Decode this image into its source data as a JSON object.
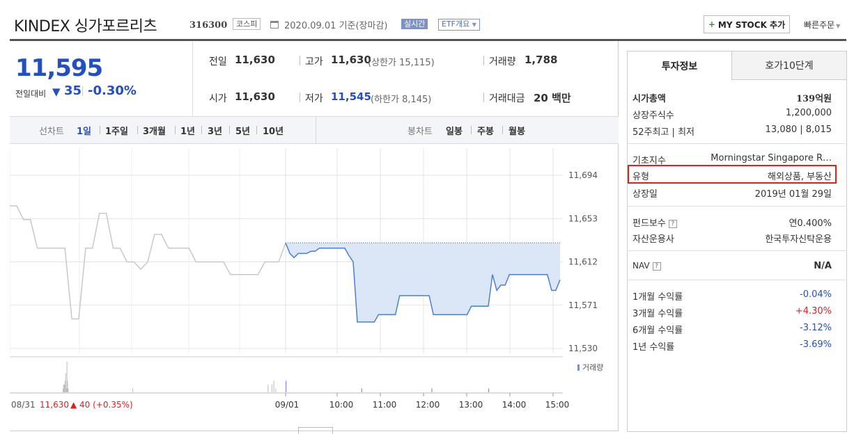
{
  "header": {
    "name": "KINDEX 싱가포르리츠",
    "code": "316300",
    "market_tag": "코스피",
    "date_text": "2020.09.01 기준(장마감)",
    "realtime_label": "실시간",
    "etf_button": "ETF개요",
    "my_stock_button": "MY STOCK 추가",
    "my_stock_plus": "+",
    "quick_order": "빠른주문"
  },
  "summary": {
    "price": "11,595",
    "diff_label": "전일대비",
    "diff_arrow": "▼",
    "diff_value": "35",
    "diff_pct": "-0.30%",
    "prev_label": "전일",
    "prev_value": "11,630",
    "high_label": "고가",
    "high_value": "11,630",
    "high_sub": "(상한가 15,115)",
    "volume_label": "거래량",
    "volume_value": "1,788",
    "open_label": "시가",
    "open_value": "11,630",
    "low_label": "저가",
    "low_value": "11,545",
    "low_sub": "(하한가 8,145)",
    "amount_label": "거래대금",
    "amount_value": "20 백만"
  },
  "chart_tabs": {
    "line_label": "선차트",
    "line_items": [
      "1일",
      "1주일",
      "3개월",
      "1년",
      "3년",
      "5년",
      "10년"
    ],
    "candle_label": "봉차트",
    "candle_items": [
      "일봉",
      "주봉",
      "월봉"
    ]
  },
  "chart_data": {
    "type": "line",
    "y_ticks": [
      "11,694",
      "11,653",
      "11,612",
      "11,571",
      "11,530"
    ],
    "x_ticks": [
      "09/01",
      "10:00",
      "11:00",
      "12:00",
      "13:00",
      "14:00",
      "15:00"
    ],
    "prev_day_label": "08/31",
    "prev_day_value": "11,630",
    "prev_day_change": "▲ 40 (+0.35%)",
    "volume_legend": "거래량",
    "ylim": [
      11530,
      11694
    ],
    "grid": true,
    "colors": {
      "today_line": "#4a7fd6",
      "today_fill": "#dbe6f6",
      "prev_line": "#c8c8c8",
      "prev_close": "#3355aa",
      "volume_bar": "#bbbbbb",
      "volume_today": "#7d8fd0"
    },
    "prev_series": [
      11665,
      11665,
      11652,
      11652,
      11625,
      11625,
      11625,
      11625,
      11625,
      11558,
      11558,
      11625,
      11625,
      11658,
      11658,
      11625,
      11625,
      11612,
      11612,
      11605,
      11612,
      11638,
      11638,
      11625,
      11625,
      11625,
      11625,
      11612,
      11612,
      11612,
      11612,
      11612,
      11600,
      11600,
      11600,
      11600,
      11600,
      11612,
      11612,
      11612,
      11630
    ],
    "today_series": [
      11630,
      11620,
      11616,
      11620,
      11620,
      11620,
      11622,
      11622,
      11625,
      11625,
      11625,
      11625,
      11625,
      11625,
      11625,
      11618,
      11612,
      11555,
      11555,
      11555,
      11555,
      11555,
      11562,
      11562,
      11562,
      11562,
      11562,
      11580,
      11580,
      11580,
      11580,
      11580,
      11580,
      11580,
      11580,
      11562,
      11562,
      11562,
      11562,
      11562,
      11562,
      11562,
      11562,
      11562,
      11570,
      11570,
      11570,
      11570,
      11570,
      11600,
      11585,
      11590,
      11590,
      11600,
      11600,
      11600,
      11600,
      11600,
      11600,
      11600,
      11600,
      11600,
      11600,
      11585,
      11585,
      11595
    ],
    "prev_volumes": [
      0,
      0,
      0,
      0,
      0,
      0,
      0,
      0,
      0,
      0,
      0,
      0,
      0,
      0,
      0,
      0,
      0,
      0,
      0,
      0,
      0,
      0,
      0,
      0,
      0,
      0,
      0,
      0,
      0,
      0,
      0,
      0,
      0,
      0,
      0,
      0,
      0,
      0,
      0,
      0,
      0,
      0,
      0,
      0,
      0,
      0,
      0,
      0,
      0,
      0,
      0,
      0,
      0,
      0,
      0,
      0,
      0,
      0,
      0,
      0,
      0,
      0,
      0,
      0,
      0,
      0,
      0,
      0,
      0,
      0,
      0,
      0,
      0,
      0,
      0,
      0,
      0,
      0,
      0,
      0,
      0,
      0,
      0,
      1,
      2,
      2,
      3,
      5,
      1,
      8,
      3,
      1,
      0,
      0,
      0,
      0,
      0,
      0,
      0,
      0,
      0,
      0,
      0,
      0,
      0,
      0,
      0,
      0,
      0,
      0,
      0,
      0,
      0,
      0,
      0,
      0,
      0,
      0,
      0,
      0,
      0,
      0,
      0,
      0,
      0,
      0,
      0,
      0,
      0,
      0,
      0,
      0,
      0,
      0,
      0,
      0,
      0,
      0,
      0,
      0,
      0,
      0,
      0,
      0,
      0,
      0,
      0,
      0,
      0,
      0,
      0,
      0,
      0,
      0,
      0,
      0,
      0,
      0,
      0,
      0,
      0,
      0,
      0,
      0,
      0,
      0,
      0,
      0,
      0,
      0,
      0,
      0,
      0,
      0,
      0,
      0,
      0,
      0,
      0,
      0,
      0,
      0,
      0,
      0,
      0,
      0,
      0,
      0,
      0,
      0,
      0,
      0,
      1,
      0,
      0,
      0,
      0,
      0,
      0,
      0,
      0,
      0,
      0,
      0,
      0,
      0,
      0,
      0,
      0,
      0,
      0,
      0,
      0,
      0,
      0,
      0,
      0,
      0,
      0,
      0,
      0,
      0,
      0,
      0,
      0,
      0,
      0,
      0,
      0,
      0,
      0,
      0,
      0,
      0,
      0,
      0,
      0,
      0,
      0,
      0,
      0,
      0,
      0,
      0,
      0,
      0,
      0,
      0,
      0,
      0,
      0,
      0,
      0,
      0,
      0,
      0,
      0,
      0,
      0,
      0,
      0,
      0,
      0,
      0,
      0,
      0,
      0,
      0,
      0,
      0,
      0,
      0,
      0,
      0,
      0,
      0,
      0,
      0,
      0,
      0,
      0,
      0,
      0,
      0,
      0,
      0,
      0,
      0,
      0,
      0,
      0,
      0,
      0,
      0,
      0,
      0,
      0,
      0,
      0,
      0,
      0,
      0,
      0,
      0,
      0,
      0,
      0,
      0,
      0,
      0,
      0,
      0,
      0,
      0,
      0,
      0,
      0,
      0,
      0,
      0,
      0,
      0,
      0,
      0,
      0,
      0,
      0,
      0,
      0,
      0,
      0,
      0,
      0,
      0,
      0,
      0,
      0,
      0,
      0,
      0,
      0,
      0,
      0,
      0,
      0,
      0,
      0,
      0,
      0,
      0,
      0,
      0,
      0,
      0,
      0,
      0,
      0,
      0,
      0,
      0,
      0,
      0,
      0,
      0,
      0,
      0,
      0,
      0,
      0,
      0,
      0,
      0,
      0,
      0,
      0,
      0,
      0,
      0,
      0,
      0,
      0,
      0,
      0,
      0,
      0,
      0,
      0,
      0,
      0,
      0,
      0,
      0,
      0,
      0,
      0,
      0,
      0,
      0,
      0,
      0,
      0,
      0,
      0,
      0,
      2,
      0,
      0,
      0,
      0,
      0,
      2,
      0,
      0,
      3,
      0,
      0,
      1,
      0,
      0,
      0,
      0,
      0,
      0,
      0,
      0,
      0,
      0,
      0,
      0,
      0,
      0,
      0,
      0
    ],
    "today_volumes": [
      3,
      0,
      0,
      0,
      0,
      0,
      0,
      0,
      0,
      0,
      0,
      0,
      0,
      0,
      0,
      0,
      0,
      0,
      0,
      0,
      0,
      0,
      0,
      0,
      0,
      0,
      0,
      0,
      0,
      0,
      0,
      0,
      0,
      0,
      0,
      0,
      0,
      0,
      0,
      0,
      0,
      0,
      0,
      0,
      0,
      0,
      0,
      0,
      0,
      0,
      0,
      0,
      0,
      0,
      0,
      0,
      0,
      0,
      0,
      0,
      0,
      0,
      0,
      0,
      0,
      0,
      0,
      0,
      0,
      0,
      0,
      0,
      0,
      0,
      0,
      0,
      0,
      0,
      0,
      0,
      0,
      0,
      0,
      0,
      0,
      0,
      0,
      0,
      0,
      0,
      0,
      0,
      0,
      0,
      0,
      0,
      0,
      0,
      0,
      0,
      0,
      0,
      0,
      0,
      0,
      0,
      0,
      0,
      0,
      0,
      0,
      0,
      0,
      0,
      0,
      0,
      0,
      0,
      0,
      0,
      0,
      0,
      0,
      0,
      0,
      0,
      0,
      0,
      0,
      0,
      0,
      0,
      0,
      0,
      0,
      0,
      1,
      0,
      0,
      0,
      0,
      0,
      0,
      0,
      0,
      0,
      0,
      0,
      0,
      0,
      0,
      0,
      0,
      0,
      0,
      0,
      0,
      0,
      0,
      0,
      0,
      0,
      0,
      0,
      0,
      0,
      0,
      0,
      0,
      0,
      0,
      0,
      0,
      0,
      0,
      0,
      0,
      0,
      0,
      0,
      0,
      0,
      0,
      0,
      0,
      0,
      0,
      0,
      0,
      0,
      0,
      0,
      0,
      0,
      0,
      0,
      0,
      0,
      0,
      0,
      0,
      0,
      0,
      0,
      0,
      0,
      0,
      0,
      0,
      0,
      0,
      0,
      0,
      0,
      0,
      0,
      0,
      0,
      0,
      0,
      0,
      0,
      0,
      0,
      0,
      0,
      0,
      0,
      0,
      0,
      0,
      0,
      0,
      0,
      0,
      0,
      0,
      0,
      0,
      0,
      0,
      0,
      0,
      0,
      0,
      0,
      0,
      0,
      0,
      0,
      0,
      0,
      0,
      0,
      0,
      0,
      0,
      0,
      0,
      0,
      0,
      0,
      1,
      0,
      0,
      0,
      0,
      0,
      0,
      0,
      0,
      0,
      0,
      0,
      0,
      0,
      0,
      0,
      0,
      0,
      0,
      0,
      0,
      0,
      0,
      0,
      0,
      0,
      0,
      0,
      0,
      0,
      0,
      0,
      0,
      0,
      0,
      0,
      0,
      0,
      0,
      0,
      0,
      0,
      0,
      0,
      0,
      0,
      0,
      0,
      0,
      0,
      0,
      0,
      0,
      0,
      0,
      0,
      0,
      0,
      0,
      0,
      0,
      0,
      0,
      0,
      0,
      0,
      0,
      0,
      0,
      0,
      0,
      0,
      0,
      0,
      0,
      0,
      0,
      0,
      0,
      0,
      0,
      0,
      0,
      0,
      0,
      0,
      0,
      0,
      0,
      0,
      0,
      0,
      0,
      0,
      0,
      0,
      0,
      0,
      0,
      0,
      0,
      0,
      1,
      0,
      0,
      0,
      0,
      0,
      0,
      0,
      0,
      0,
      0,
      0,
      0,
      0,
      0,
      0,
      0,
      0,
      0,
      0,
      0,
      0,
      0,
      0,
      0,
      0,
      0,
      0,
      0,
      0,
      0,
      0,
      0,
      0,
      0,
      0,
      0,
      0,
      0,
      0,
      0,
      0,
      0,
      0,
      0,
      0,
      0,
      0,
      0,
      0,
      0,
      0,
      0,
      0,
      0,
      0,
      0,
      0,
      0,
      0,
      0,
      0,
      0,
      0,
      0,
      0,
      0,
      0,
      0,
      0,
      0,
      0,
      0,
      0,
      0,
      0,
      0,
      0,
      0,
      0,
      0,
      0,
      0,
      0,
      0,
      0,
      0,
      0,
      0,
      0,
      0,
      0,
      0,
      0,
      0,
      0,
      0,
      0,
      0,
      0,
      0,
      0,
      0,
      0,
      0,
      0,
      0,
      0,
      0,
      0,
      0,
      0,
      0,
      0,
      0,
      0,
      0,
      0,
      0,
      0,
      0,
      0,
      0,
      0,
      0,
      0,
      0,
      0,
      0,
      0
    ]
  },
  "right_panel": {
    "tab_active": "투자정보",
    "tab_inactive": "호가10단계",
    "market_cap_label": "시가총액",
    "market_cap_value": "139억원",
    "shares_label": "상장주식수",
    "shares_value": "1,200,000",
    "week52_label": "52주최고 | 최저",
    "week52_value": "13,080 | 8,015",
    "index_label": "기초지수",
    "index_value": "Morningstar Singapore R…",
    "type_label": "유형",
    "type_value": "해외상품, 부동산",
    "listing_label": "상장일",
    "listing_value": "2019년 01월 29일",
    "fee_label": "펀드보수",
    "fee_value": "연0.400%",
    "manager_label": "자산운용사",
    "manager_value": "한국투자신탁운용",
    "nav_label": "NAV",
    "nav_value": "N/A",
    "help_glyph": "?",
    "returns": [
      {
        "label": "1개월 수익률",
        "value": "-0.04%",
        "color": "#2250c4"
      },
      {
        "label": "3개월 수익률",
        "value": "+4.30%",
        "color": "#d62222"
      },
      {
        "label": "6개월 수익률",
        "value": "-3.12%",
        "color": "#2250c4"
      },
      {
        "label": "1년 수익률",
        "value": "-3.69%",
        "color": "#2250c4"
      }
    ]
  }
}
